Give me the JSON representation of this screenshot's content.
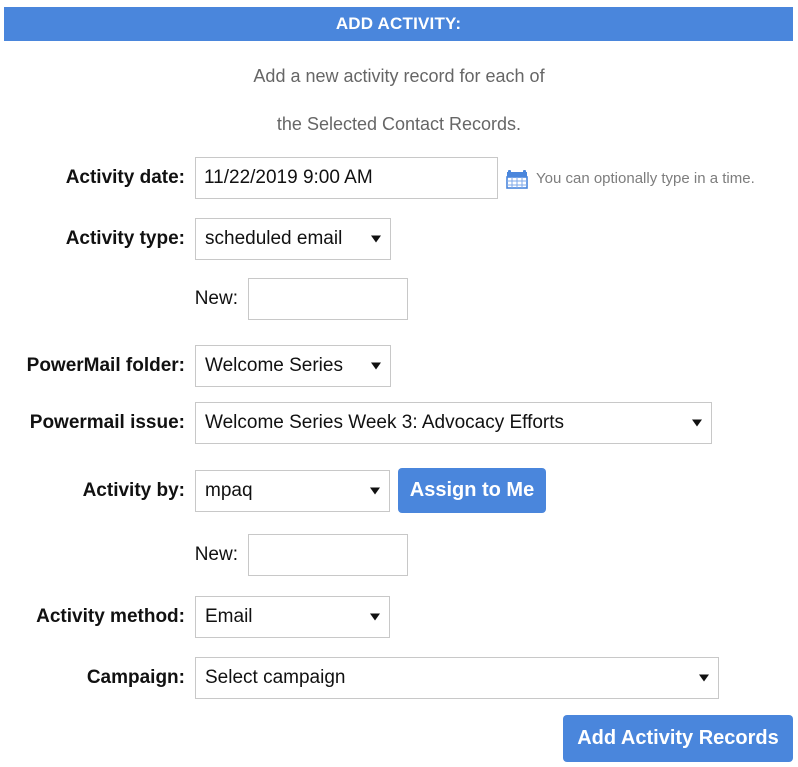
{
  "header": {
    "title": "ADD ACTIVITY:",
    "bar_color": "#4a86dc"
  },
  "intro": {
    "line1": "Add a new activity record for each of",
    "line2": "the Selected Contact Records."
  },
  "form": {
    "activity_date": {
      "label": "Activity date:",
      "value": "11/22/2019 9:00 AM",
      "placeholder": "",
      "calendar_icon": "calendar-icon",
      "hint": "You can optionally type in a time."
    },
    "activity_type": {
      "label": "Activity type:",
      "value": "scheduled email",
      "caret": "chevron-down-icon"
    },
    "activity_type_new": {
      "label": "New:",
      "value": "",
      "placeholder": ""
    },
    "powermail_folder": {
      "label": "PowerMail folder:",
      "value": "Welcome Series",
      "caret": "chevron-down-icon"
    },
    "powermail_issue": {
      "label": "Powermail issue:",
      "value": "Welcome Series Week 3: Advocacy Efforts",
      "caret": "chevron-down-icon"
    },
    "activity_by": {
      "label": "Activity by:",
      "value": "mpaq",
      "caret": "chevron-down-icon",
      "assign_button": "Assign to Me"
    },
    "activity_by_new": {
      "label": "New:",
      "value": "",
      "placeholder": ""
    },
    "activity_method": {
      "label": "Activity method:",
      "value": "Email",
      "caret": "chevron-down-icon"
    },
    "campaign": {
      "label": "Campaign:",
      "value": "Select campaign",
      "caret": "chevron-down-icon"
    }
  },
  "actions": {
    "submit_label": "Add Activity Records",
    "button_color": "#4a86dc"
  }
}
